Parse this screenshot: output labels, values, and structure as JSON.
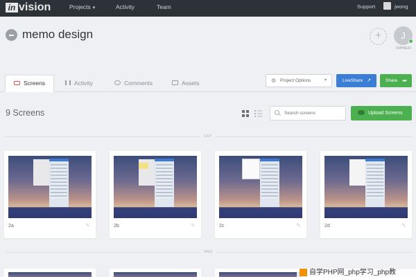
{
  "nav": {
    "logo_in": "in",
    "logo_rest": "vision",
    "items": [
      {
        "label": "Projects",
        "caret": "▾"
      },
      {
        "label": "Activity"
      },
      {
        "label": "Team"
      }
    ],
    "support": "Support",
    "username": "jwong"
  },
  "project": {
    "title": "memo design",
    "add_symbol": "+",
    "owner_initial": "J",
    "owner_label": "OWNER"
  },
  "tabs": [
    {
      "label": "Screens",
      "active": true,
      "icon": "monitor-icon"
    },
    {
      "label": "Activity",
      "icon": "bar-chart-icon"
    },
    {
      "label": "Comments",
      "icon": "speech-bubble-icon"
    },
    {
      "label": "Assets",
      "icon": "folder-icon"
    }
  ],
  "actions": {
    "project_options": "Project Options",
    "liveshare": "LiveShare",
    "share": "Share"
  },
  "screens": {
    "count_label": "9 Screens",
    "search_placeholder": "Search screens",
    "upload_label": "Upload Screens",
    "sections": [
      {
        "label": "1ST"
      },
      {
        "label": "2ND"
      }
    ],
    "cards": [
      {
        "label": "2a"
      },
      {
        "label": "2b"
      },
      {
        "label": "2c"
      },
      {
        "label": "2d"
      }
    ]
  },
  "colors": {
    "topbar": "#2d3239",
    "liveshare": "#3a7fd5",
    "green": "#4caf50",
    "active_tab_icon": "#e05a4b"
  },
  "watermark": "自学PHP网_php学习_php教"
}
